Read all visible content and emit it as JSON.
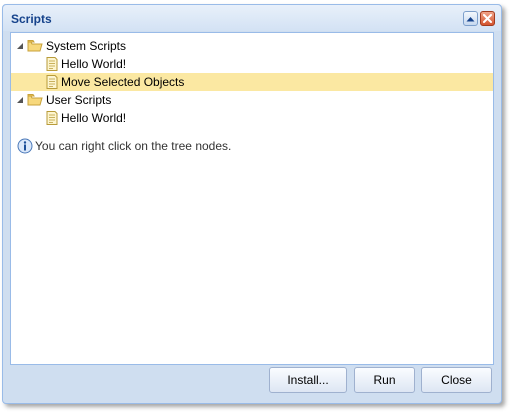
{
  "window": {
    "title": "Scripts"
  },
  "tree": {
    "nodes": [
      {
        "label": "System Scripts",
        "type": "folder",
        "expanded": true,
        "depth": 0
      },
      {
        "label": "Hello World!",
        "type": "script",
        "depth": 1
      },
      {
        "label": "Move Selected Objects",
        "type": "script",
        "depth": 1,
        "selected": true
      },
      {
        "label": "User Scripts",
        "type": "folder",
        "expanded": true,
        "depth": 0
      },
      {
        "label": "Hello World!",
        "type": "script",
        "depth": 1
      }
    ]
  },
  "hint": {
    "text": "You can right click on the tree nodes.",
    "icon": "info-icon"
  },
  "buttons": {
    "install": "Install...",
    "run": "Run",
    "close": "Close"
  },
  "colors": {
    "title": "#15428b",
    "selection": "#fbe8a2",
    "border": "#99bbe8",
    "window_bg": "#cfdef0",
    "close_tool": "#d4542e"
  }
}
